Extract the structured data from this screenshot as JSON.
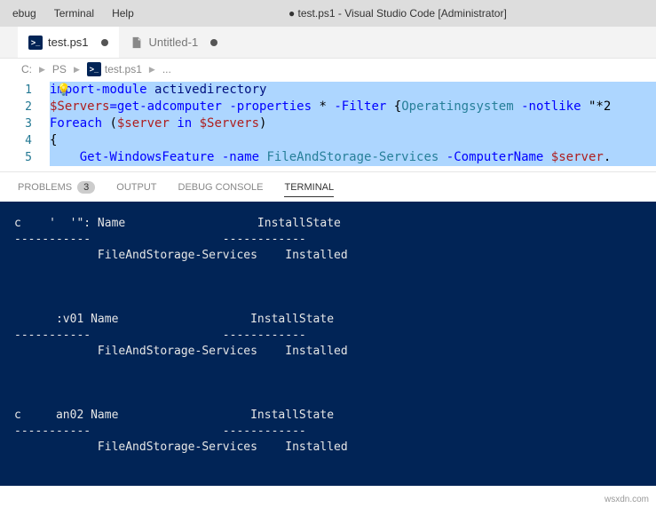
{
  "menubar": {
    "items": [
      "ebug",
      "Terminal",
      "Help"
    ],
    "title": "● test.ps1 - Visual Studio Code [Administrator]"
  },
  "tabs": [
    {
      "label": "test.ps1",
      "modified": true,
      "active": true
    },
    {
      "label": "Untitled-1",
      "modified": true,
      "active": false
    }
  ],
  "breadcrumbs": {
    "segments": [
      "C:",
      "PS",
      "test.ps1",
      "..."
    ]
  },
  "editor": {
    "lines": [
      {
        "num": "1",
        "tokens": [
          {
            "t": "i",
            "c": "kw"
          },
          {
            "t": "mp",
            "c": "kw lightbulb-spot"
          },
          {
            "t": "ort-module",
            "c": "kw"
          },
          {
            "t": " ",
            "c": "plain"
          },
          {
            "t": "activedirectory",
            "c": "module"
          }
        ]
      },
      {
        "num": "2",
        "tokens": [
          {
            "t": "$Servers",
            "c": "var"
          },
          {
            "t": "=",
            "c": "op"
          },
          {
            "t": "get-adcomputer",
            "c": "kw"
          },
          {
            "t": " ",
            "c": "plain"
          },
          {
            "t": "-properties",
            "c": "op"
          },
          {
            "t": " * ",
            "c": "plain"
          },
          {
            "t": "-Filter",
            "c": "op"
          },
          {
            "t": " {",
            "c": "punct"
          },
          {
            "t": "Operatingsystem",
            "c": "type"
          },
          {
            "t": " ",
            "c": "plain"
          },
          {
            "t": "-notlike",
            "c": "op"
          },
          {
            "t": " \"*2",
            "c": "plain"
          }
        ]
      },
      {
        "num": "3",
        "tokens": [
          {
            "t": "Foreach",
            "c": "kw"
          },
          {
            "t": " (",
            "c": "punct"
          },
          {
            "t": "$server",
            "c": "var"
          },
          {
            "t": " in ",
            "c": "kw"
          },
          {
            "t": "$Servers",
            "c": "var"
          },
          {
            "t": ")",
            "c": "punct"
          }
        ]
      },
      {
        "num": "4",
        "tokens": [
          {
            "t": "{",
            "c": "punct"
          }
        ]
      },
      {
        "num": "5",
        "tokens": [
          {
            "t": "    ",
            "c": "plain"
          },
          {
            "t": "Get-WindowsFeature",
            "c": "kw"
          },
          {
            "t": " ",
            "c": "plain"
          },
          {
            "t": "-name",
            "c": "op"
          },
          {
            "t": " ",
            "c": "plain"
          },
          {
            "t": "FileAndStorage-Services",
            "c": "type"
          },
          {
            "t": " ",
            "c": "plain"
          },
          {
            "t": "-ComputerName",
            "c": "op"
          },
          {
            "t": " ",
            "c": "plain"
          },
          {
            "t": "$server",
            "c": "var"
          },
          {
            "t": ".",
            "c": "punct"
          }
        ]
      }
    ]
  },
  "panel": {
    "tabs": {
      "problems": "PROBLEMS",
      "problems_count": "3",
      "output": "OUTPUT",
      "debug": "DEBUG CONSOLE",
      "terminal": "TERMINAL"
    }
  },
  "terminal": {
    "blocks": [
      {
        "header": "c    '  '\": Name                   InstallState",
        "sep": "-----------                   ------------",
        "row": "            FileAndStorage-Services    Installed"
      },
      {
        "header": "      :v01 Name                   InstallState",
        "sep": "-----------                   ------------",
        "row": "            FileAndStorage-Services    Installed"
      },
      {
        "header": "c     an02 Name                   InstallState",
        "sep": "-----------                   ------------",
        "row": "            FileAndStorage-Services    Installed"
      }
    ]
  },
  "watermark": "wsxdn.com"
}
